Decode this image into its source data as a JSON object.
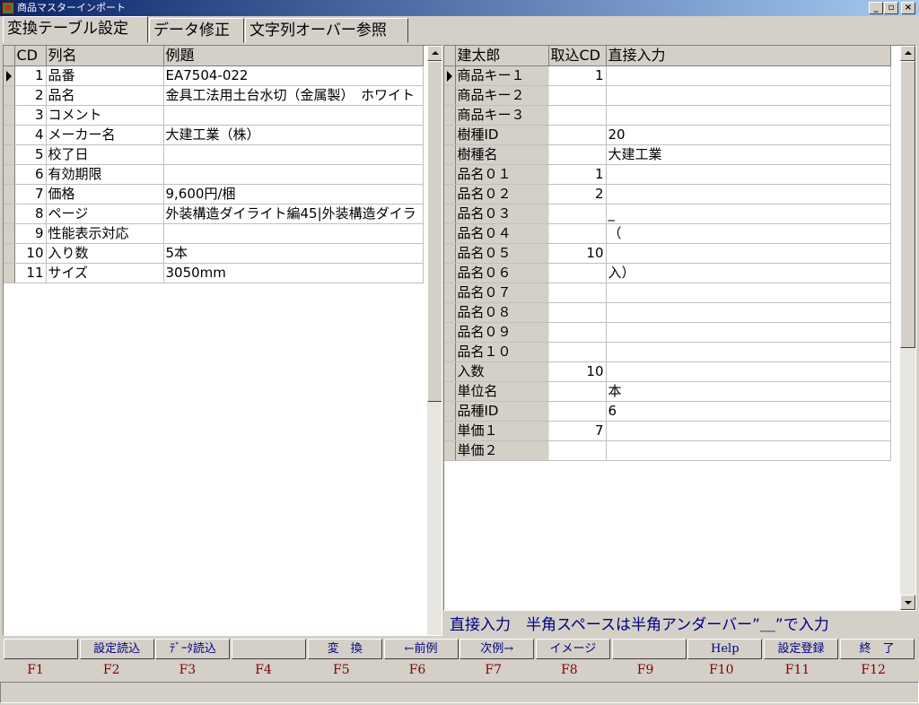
{
  "window": {
    "title": "商品マスターインポート",
    "min_glyph": "_",
    "max_glyph": "▫",
    "close_glyph": "×"
  },
  "tabs": [
    "変換テーブル設定",
    "データ修正",
    "文字列オーバー参照"
  ],
  "left_grid": {
    "headers": [
      "CD",
      "列名",
      "例題"
    ],
    "rows": [
      {
        "cd": "1",
        "name": "品番",
        "example": "EA7504-022"
      },
      {
        "cd": "2",
        "name": "品名",
        "example": "金具工法用土台水切（金属製）　ホワイト"
      },
      {
        "cd": "3",
        "name": "コメント",
        "example": ""
      },
      {
        "cd": "4",
        "name": "メーカー名",
        "example": "大建工業（株）"
      },
      {
        "cd": "5",
        "name": "校了日",
        "example": ""
      },
      {
        "cd": "6",
        "name": "有効期限",
        "example": ""
      },
      {
        "cd": "7",
        "name": "価格",
        "example": "9,600円/梱"
      },
      {
        "cd": "8",
        "name": "ページ",
        "example": "外装構造ダイライト編45|外装構造ダイラ"
      },
      {
        "cd": "9",
        "name": "性能表示対応",
        "example": ""
      },
      {
        "cd": "10",
        "name": "入り数",
        "example": "5本"
      },
      {
        "cd": "11",
        "name": "サイズ",
        "example": "3050mm"
      }
    ]
  },
  "right_grid": {
    "headers": [
      "建太郎",
      "取込CD",
      "直接入力"
    ],
    "rows": [
      {
        "field": "商品キー１",
        "cd": "1",
        "direct": ""
      },
      {
        "field": "商品キー２",
        "cd": "",
        "direct": ""
      },
      {
        "field": "商品キー３",
        "cd": "",
        "direct": ""
      },
      {
        "field": "樹種ID",
        "cd": "",
        "direct": "20"
      },
      {
        "field": "樹種名",
        "cd": "",
        "direct": "大建工業"
      },
      {
        "field": "品名０１",
        "cd": "1",
        "direct": ""
      },
      {
        "field": "品名０２",
        "cd": "2",
        "direct": ""
      },
      {
        "field": "品名０３",
        "cd": "",
        "direct": "_"
      },
      {
        "field": "品名０４",
        "cd": "",
        "direct": "（"
      },
      {
        "field": "品名０５",
        "cd": "10",
        "direct": ""
      },
      {
        "field": "品名０６",
        "cd": "",
        "direct": "入）"
      },
      {
        "field": "品名０７",
        "cd": "",
        "direct": ""
      },
      {
        "field": "品名０８",
        "cd": "",
        "direct": ""
      },
      {
        "field": "品名０９",
        "cd": "",
        "direct": ""
      },
      {
        "field": "品名１０",
        "cd": "",
        "direct": ""
      },
      {
        "field": "入数",
        "cd": "10",
        "direct": ""
      },
      {
        "field": "単位名",
        "cd": "",
        "direct": "本"
      },
      {
        "field": "品種ID",
        "cd": "",
        "direct": "6"
      },
      {
        "field": "単価１",
        "cd": "7",
        "direct": ""
      },
      {
        "field": "単価２",
        "cd": "",
        "direct": ""
      }
    ]
  },
  "hint": "直接入力　半角スペースは半角アンダーバー”＿”で入力",
  "fbuttons": [
    "",
    "設定読込",
    "ﾃﾞｰﾀ読込",
    "",
    "変　換",
    "←前例",
    "次例→",
    "イメージ",
    "",
    "Help",
    "設定登録",
    "終　了"
  ],
  "fkeys": [
    "F1",
    "F2",
    "F3",
    "F4",
    "F5",
    "F6",
    "F7",
    "F8",
    "F9",
    "F10",
    "F11",
    "F12"
  ]
}
